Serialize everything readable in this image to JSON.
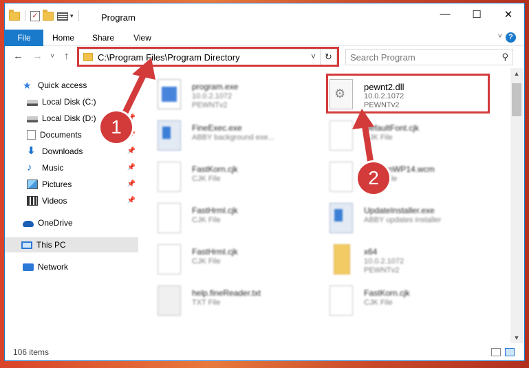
{
  "window": {
    "title": "Program",
    "controls": {
      "minimize": "—",
      "maximize": "☐",
      "close": "✕"
    }
  },
  "ribbon": {
    "tabs": [
      "File",
      "Home",
      "Share",
      "View"
    ],
    "help": "?"
  },
  "nav": {
    "back": "←",
    "forward": "→",
    "recent": "˅",
    "up": "↑",
    "address": "C:\\Program Files\\Program Directory",
    "search_placeholder": "Search Program"
  },
  "sidebar": {
    "quick_access": "Quick access",
    "items": [
      {
        "label": "Local Disk (C:)",
        "pinned": true
      },
      {
        "label": "Local Disk (D:)",
        "pinned": true
      },
      {
        "label": "Documents",
        "pinned": true
      },
      {
        "label": "Downloads",
        "pinned": true
      },
      {
        "label": "Music",
        "pinned": true
      },
      {
        "label": "Pictures",
        "pinned": true
      },
      {
        "label": "Videos",
        "pinned": true
      }
    ],
    "onedrive": "OneDrive",
    "this_pc": "This PC",
    "network": "Network"
  },
  "files": [
    {
      "name": "program.exe",
      "sub1": "10.0.2.1072",
      "sub2": "PEWNTv2",
      "icon": "exe-icon"
    },
    {
      "name": "pewnt2.dll",
      "sub1": "10.0.2.1072",
      "sub2": "PEWNTv2",
      "icon": "dll-icon"
    },
    {
      "name": "FineExec.exe",
      "sub1": "ABBY background exe...",
      "sub2": "",
      "icon": "app-icon"
    },
    {
      "name": "DefaultFont.cjk",
      "sub1": "CJK File",
      "sub2": "",
      "icon": "doc-icon"
    },
    {
      "name": "FastKorn.cjk",
      "sub1": "CJK File",
      "sub2": "",
      "icon": "doc-icon"
    },
    {
      "name": "SimSunWP14.wcm",
      "sub1": "WCM File",
      "sub2": "",
      "icon": "doc-icon"
    },
    {
      "name": "FastHrml.cjk",
      "sub1": "CJK File",
      "sub2": "",
      "icon": "doc-icon"
    },
    {
      "name": "UpdateInstaller.exe",
      "sub1": "ABBY updates installer",
      "sub2": "",
      "icon": "app-icon"
    },
    {
      "name": "FastHrml.cjk",
      "sub1": "CJK File",
      "sub2": "",
      "icon": "doc-icon"
    },
    {
      "name": "x64",
      "sub1": "10.0.2.1072",
      "sub2": "PEWNTv2",
      "icon": "folder-icon"
    },
    {
      "name": "help.fineReader.txt",
      "sub1": "TXT File",
      "sub2": "",
      "icon": "doc-icon"
    },
    {
      "name": "FastKorn.cjk",
      "sub1": "CJK File",
      "sub2": "",
      "icon": "doc-icon"
    }
  ],
  "status": {
    "count": "106 items"
  },
  "annotations": {
    "step1": "1",
    "step2": "2",
    "accent": "#d33a3a"
  }
}
